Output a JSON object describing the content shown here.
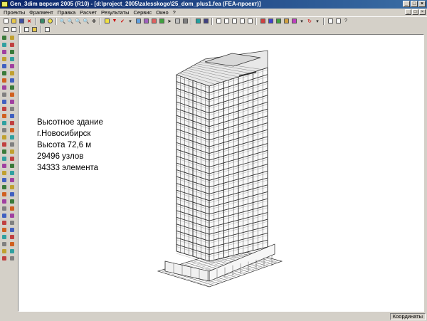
{
  "window": {
    "title": "Gen_3dim версия 2005 (R10) - [d:\\project_2005\\zalesskogo\\25_dom_plus1.fea  (FEA-проект)]"
  },
  "menubar": {
    "items": [
      "Проекты",
      "Фрагмент",
      "Правка",
      "Расчет",
      "Результаты",
      "Сервис",
      "Окно",
      "?"
    ]
  },
  "canvas": {
    "info_lines": [
      "Высотное здание",
      "г.Новосибирск",
      "Высота 72,6 м",
      "29496 узлов",
      "34333 элемента"
    ]
  },
  "statusbar": {
    "coordinates_label": "Координаты"
  },
  "colors": {
    "title_bar": "#0a246a",
    "window_bg": "#d4d0c8",
    "canvas_bg": "#ffffff",
    "mesh_line": "#303030"
  }
}
